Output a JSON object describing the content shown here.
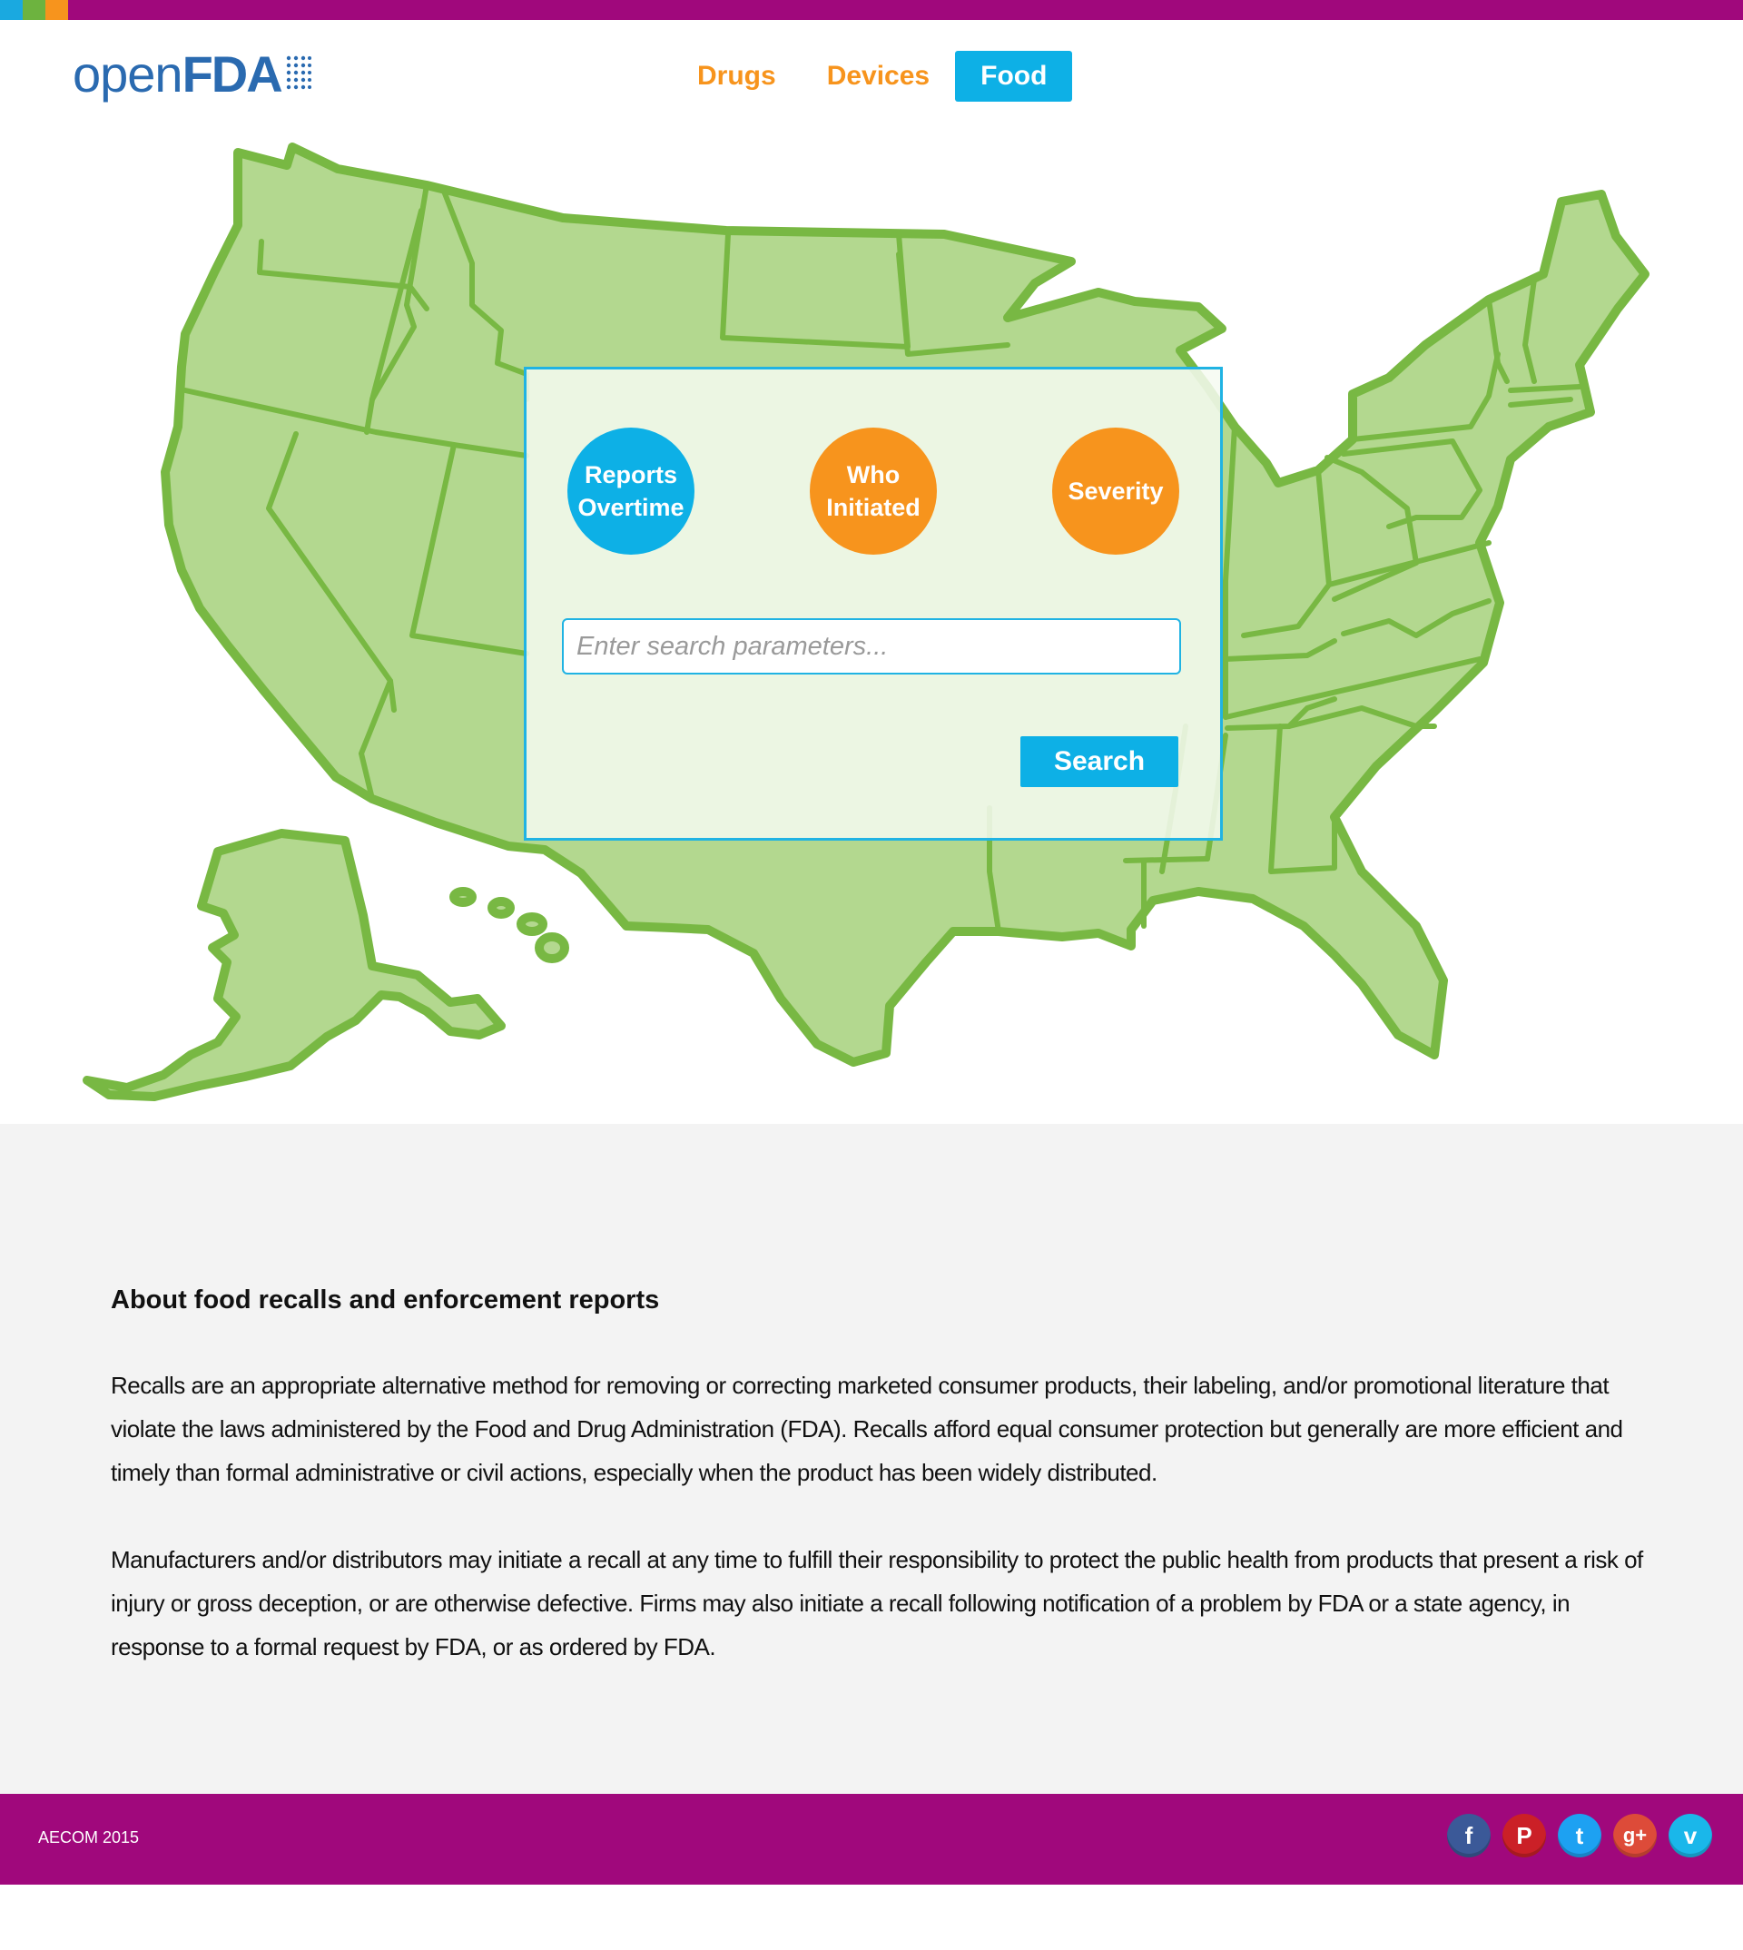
{
  "brand": {
    "logo_open": "open",
    "logo_fda": "FDA",
    "top_strip_colors": [
      "#1aa9e0",
      "#6db33f",
      "#f7941d",
      "#a0087c"
    ]
  },
  "nav": {
    "tabs": [
      {
        "label": "Drugs",
        "active": false
      },
      {
        "label": "Devices",
        "active": false
      },
      {
        "label": "Food",
        "active": true
      }
    ]
  },
  "search_panel": {
    "filters": [
      {
        "label_line1": "Reports",
        "label_line2": "Overtime",
        "color": "#0db0e6"
      },
      {
        "label_line1": "Who",
        "label_line2": "Initiated",
        "color": "#f7941d"
      },
      {
        "label_line1": "Severity",
        "label_line2": "",
        "color": "#f7941d"
      }
    ],
    "input_placeholder": "Enter search parameters...",
    "input_value": "",
    "search_button": "Search"
  },
  "map": {
    "fill_color": "#b3d88f",
    "stroke_color": "#78b843"
  },
  "about": {
    "heading": "About food recalls and enforcement reports",
    "paragraph1": "Recalls are an appropriate alternative method for removing or correcting marketed consumer products, their labeling, and/or promotional literature that violate the laws administered by the Food and Drug Administration (FDA). Recalls afford equal consumer protection but generally are more efficient and timely than formal administrative or civil actions, especially when the product has been widely distributed.",
    "paragraph2": "Manufacturers and/or distributors may initiate a recall at any time to fulfill their responsibility to protect the public health from products that present a risk of injury or gross deception, or are otherwise defective. Firms may also initiate a recall following notification of a problem by FDA or a state agency, in response to a formal request by FDA, or as ordered by FDA."
  },
  "footer": {
    "copyright": "AECOM 2015",
    "social": [
      {
        "icon": "facebook-icon",
        "glyph": "f",
        "color": "#3b5998"
      },
      {
        "icon": "pinterest-icon",
        "glyph": "P",
        "color": "#cb2027"
      },
      {
        "icon": "twitter-icon",
        "glyph": "t",
        "color": "#1da1f2"
      },
      {
        "icon": "google-plus-icon",
        "glyph": "g+",
        "color": "#dd4b39"
      },
      {
        "icon": "vimeo-icon",
        "glyph": "v",
        "color": "#1ab7ea"
      }
    ]
  }
}
